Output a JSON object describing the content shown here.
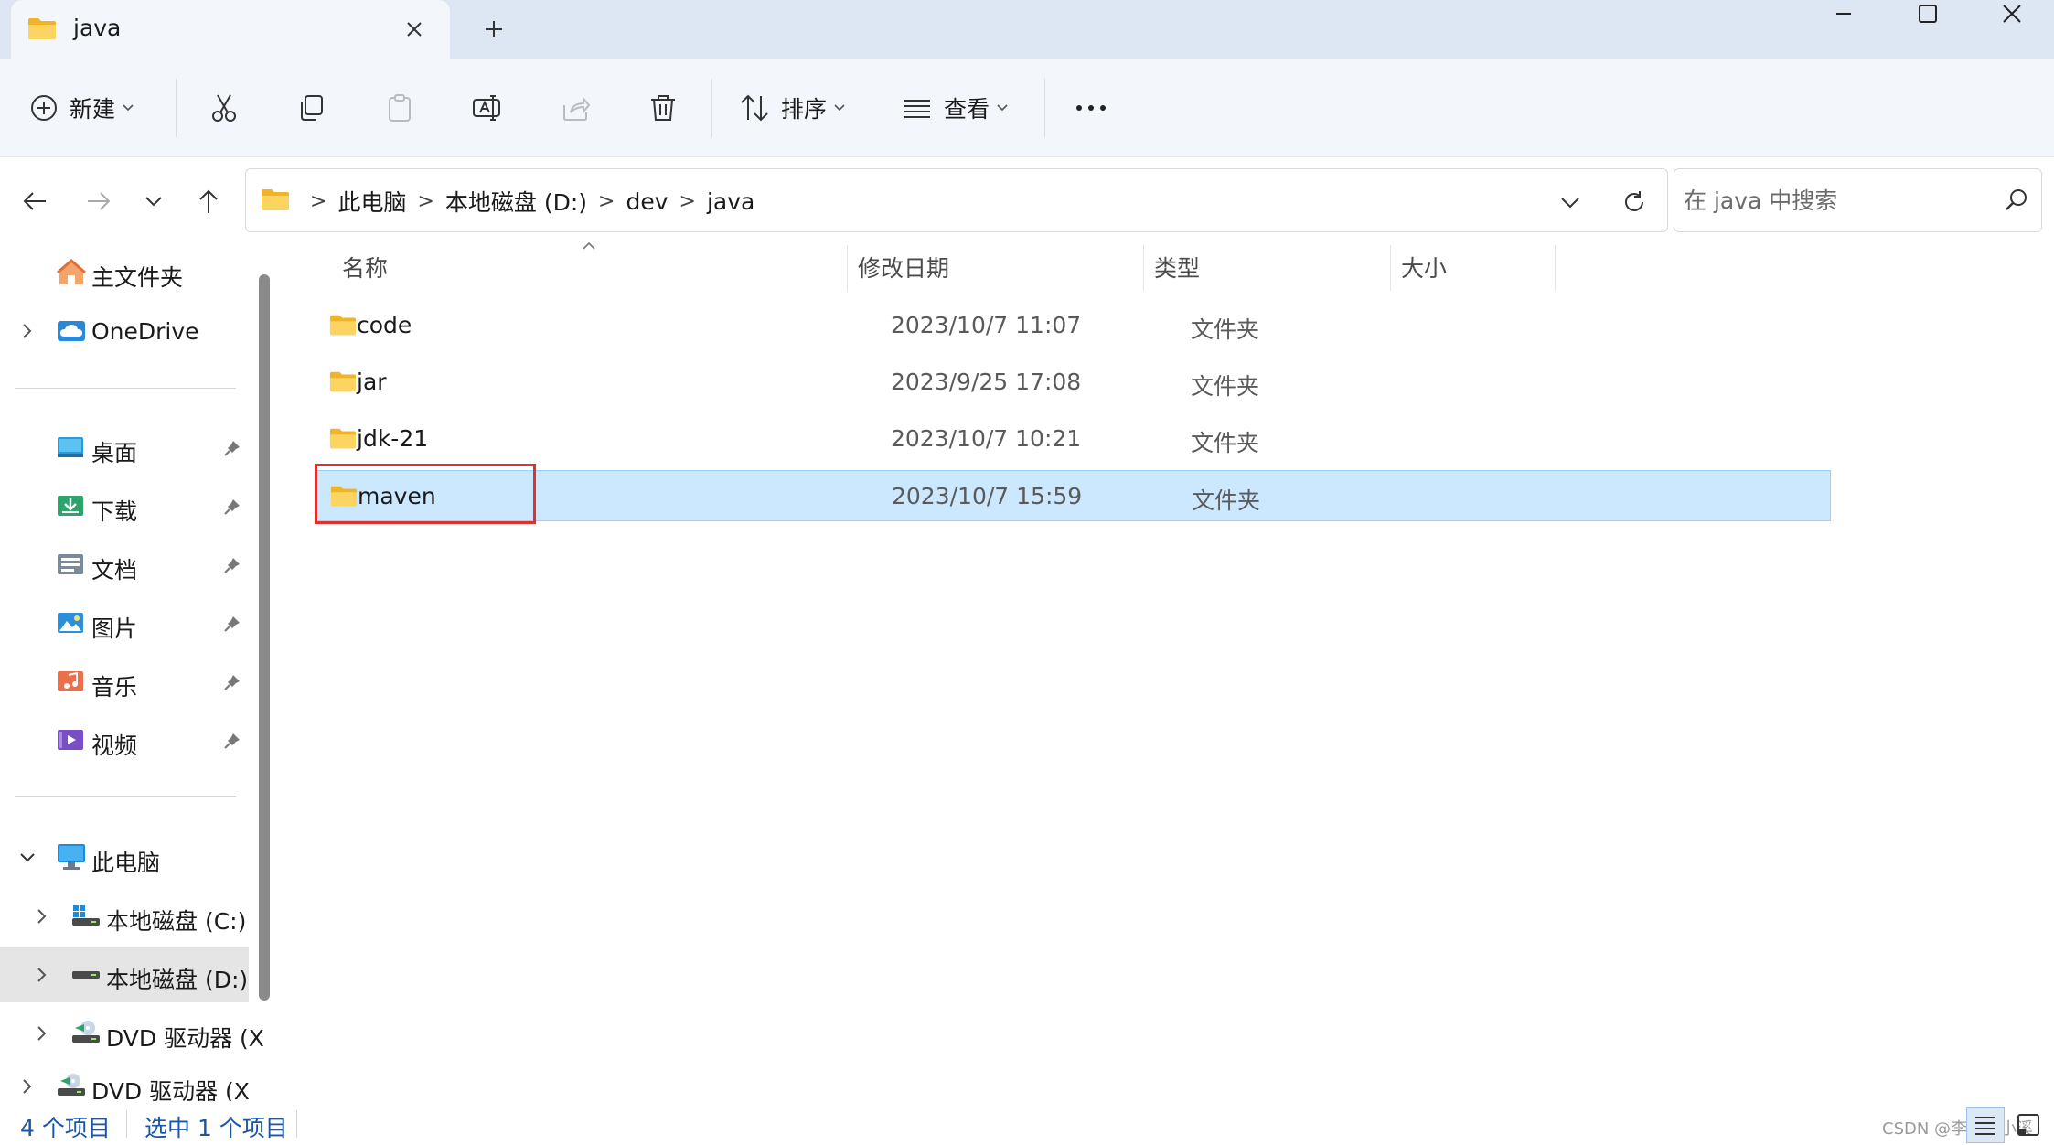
{
  "window": {
    "tab_title": "java"
  },
  "toolbar": {
    "new_label": "新建",
    "sort_label": "排序",
    "view_label": "查看"
  },
  "address": {
    "crumbs": [
      "此电脑",
      "本地磁盘 (D:)",
      "dev",
      "java"
    ],
    "separator": ">"
  },
  "search": {
    "placeholder": "在 java 中搜索"
  },
  "sidebar": {
    "home": "主文件夹",
    "onedrive": "OneDrive",
    "quick": [
      "桌面",
      "下载",
      "文档",
      "图片",
      "音乐",
      "视频"
    ],
    "this_pc": "此电脑",
    "drives": [
      "本地磁盘 (C:)",
      "本地磁盘 (D:)",
      "DVD 驱动器 (X",
      "DVD 驱动器 (X:)"
    ]
  },
  "columns": {
    "name": "名称",
    "date": "修改日期",
    "type": "类型",
    "size": "大小"
  },
  "files": [
    {
      "name": "code",
      "date": "2023/10/7 11:07",
      "type": "文件夹"
    },
    {
      "name": "jar",
      "date": "2023/9/25 17:08",
      "type": "文件夹"
    },
    {
      "name": "jdk-21",
      "date": "2023/10/7 10:21",
      "type": "文件夹"
    },
    {
      "name": "maven",
      "date": "2023/10/7 15:59",
      "type": "文件夹"
    }
  ],
  "status": {
    "count": "4 个项目",
    "selected": "选中 1 个项目",
    "watermark": "CSDN @李奥吉小溪"
  },
  "colors": {
    "selection": "#cce8ff",
    "highlight_box": "#e03131",
    "folder": "#f7c948"
  }
}
